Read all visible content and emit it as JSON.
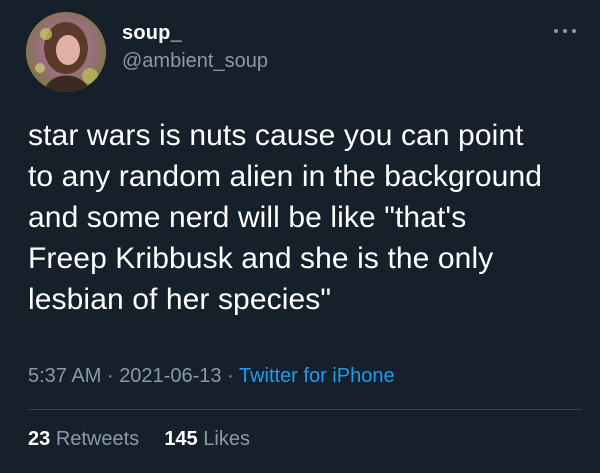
{
  "user": {
    "display_name": "soup_",
    "handle": "@ambient_soup",
    "avatar_icon": "profile-photo"
  },
  "more_icon": "more-dots-icon",
  "tweet": {
    "text": "star wars is nuts cause you can point\nto any random alien in the background\nand some nerd will be like \"that's\nFreep Kribbusk and she is the only\nlesbian of her species\""
  },
  "meta": {
    "time": "5:37 AM",
    "date": "2021-06-13",
    "separator": "·",
    "source": "Twitter for iPhone"
  },
  "stats": {
    "retweets_count": "23",
    "retweets_label": "Retweets",
    "likes_count": "145",
    "likes_label": "Likes"
  },
  "colors": {
    "background": "#15202b",
    "text_primary": "#ffffff",
    "text_secondary": "#8b98a5",
    "link": "#1d9bf0",
    "divider": "#38444d"
  }
}
